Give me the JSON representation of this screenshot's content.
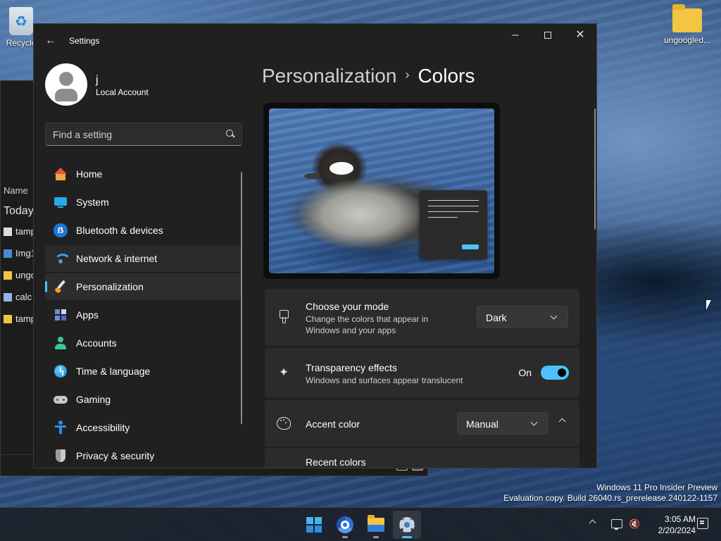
{
  "desktop": {
    "recycle_label": "Recycle",
    "folder_label": "ungoogled..."
  },
  "explorer": {
    "column_header": "Name",
    "group_label": "Today",
    "files": [
      {
        "name": "tamp",
        "icon": "app-icon"
      },
      {
        "name": "Img1",
        "icon": "image-icon"
      },
      {
        "name": "ungo",
        "icon": "zip-folder-icon"
      },
      {
        "name": "calc",
        "icon": "text-file-icon"
      },
      {
        "name": "tamp",
        "icon": "folder-icon"
      }
    ]
  },
  "settings": {
    "title": "Settings",
    "user": {
      "name": "j",
      "account_type": "Local Account"
    },
    "search": {
      "placeholder": "Find a setting"
    },
    "nav": [
      {
        "label": "Home",
        "icon": "home-icon"
      },
      {
        "label": "System",
        "icon": "system-icon"
      },
      {
        "label": "Bluetooth & devices",
        "icon": "bluetooth-icon"
      },
      {
        "label": "Network & internet",
        "icon": "network-icon"
      },
      {
        "label": "Personalization",
        "icon": "personalization-icon"
      },
      {
        "label": "Apps",
        "icon": "apps-icon"
      },
      {
        "label": "Accounts",
        "icon": "accounts-icon"
      },
      {
        "label": "Time & language",
        "icon": "time-language-icon"
      },
      {
        "label": "Gaming",
        "icon": "gaming-icon"
      },
      {
        "label": "Accessibility",
        "icon": "accessibility-icon"
      },
      {
        "label": "Privacy & security",
        "icon": "privacy-icon"
      }
    ],
    "selected_nav": "Personalization",
    "breadcrumb": {
      "parent": "Personalization",
      "separator": "›",
      "current": "Colors"
    },
    "mode": {
      "title": "Choose your mode",
      "description": "Change the colors that appear in Windows and your apps",
      "value": "Dark"
    },
    "transparency": {
      "title": "Transparency effects",
      "description": "Windows and surfaces appear translucent",
      "state_label": "On",
      "enabled": true
    },
    "accent": {
      "title": "Accent color",
      "value": "Manual",
      "recent_colors_label": "Recent colors"
    },
    "colors": {
      "accent": "#4cc2ff",
      "window_bg": "#202020",
      "card_bg": "#2b2b2b"
    }
  },
  "watermark": {
    "line1": "Windows 11 Pro Insider Preview",
    "line2": "Evaluation copy. Build 26040.rs_prerelease.240122-1157"
  },
  "taskbar": {
    "time": "3:05 AM",
    "date": "2/20/2024"
  }
}
